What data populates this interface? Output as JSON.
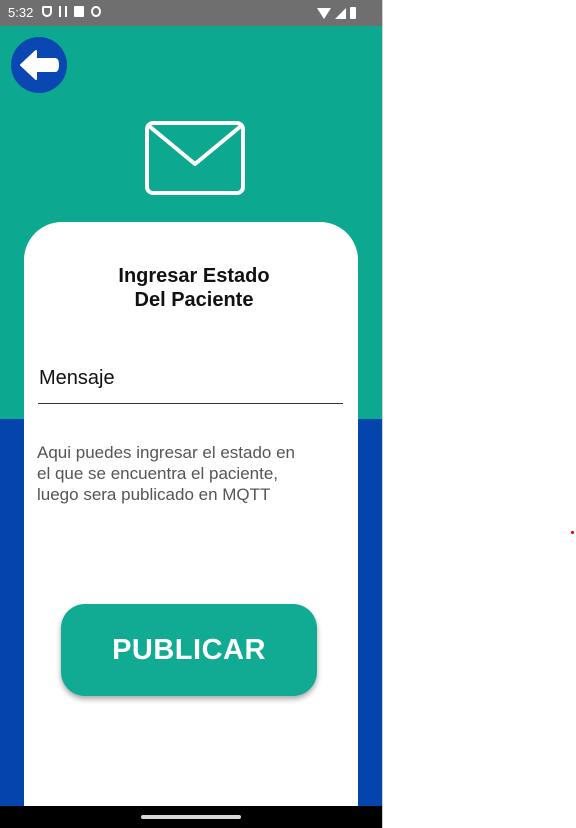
{
  "status_bar": {
    "time": "5:32",
    "left_icons": [
      "shield-icon",
      "download-icon",
      "sd-card-icon",
      "sync-icon"
    ],
    "right_icons": [
      "wifi-icon",
      "signal-icon",
      "battery-icon"
    ]
  },
  "colors": {
    "teal": "#0ca88f",
    "blue": "#0445ad",
    "button": "#10ab92",
    "card": "#ffffff"
  },
  "header": {
    "back_icon": "arrow-left-icon",
    "mail_icon": "envelope-icon"
  },
  "form": {
    "title_line1": "Ingresar Estado",
    "title_line2": "Del Paciente",
    "message_placeholder": "Mensaje",
    "message_value": "",
    "helper_text": "Aqui puedes ingresar el estado en el que se encuentra el paciente, luego sera publicado en MQTT",
    "publish_label": "PUBLICAR"
  }
}
